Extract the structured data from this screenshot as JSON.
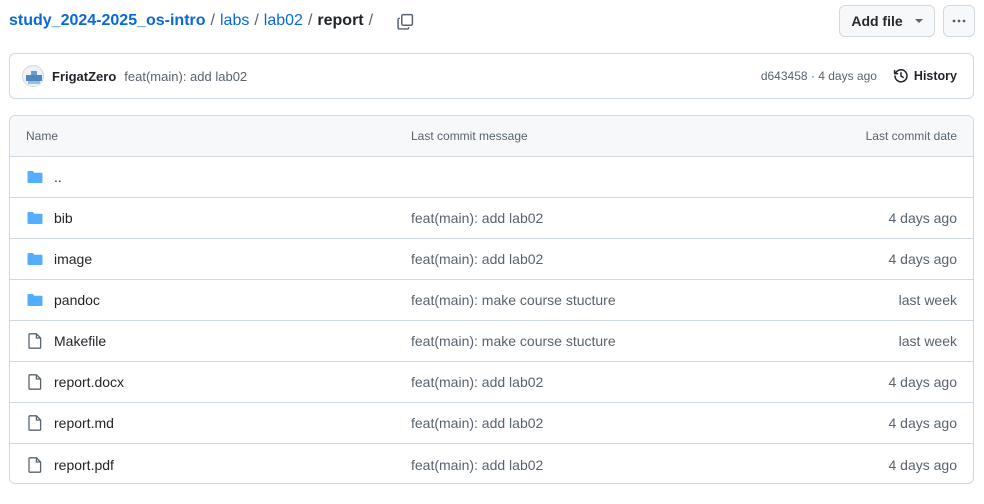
{
  "breadcrumb": {
    "repo": "study_2024-2025_os-intro",
    "parts": [
      "labs",
      "lab02"
    ],
    "current": "report",
    "separator": "/"
  },
  "actions": {
    "add_file_label": "Add file",
    "more_icon": "kebab-horizontal-icon",
    "copy_icon": "copy-icon"
  },
  "latest_commit": {
    "author": "FrigatZero",
    "message": "feat(main): add lab02",
    "meta": "d643458 · 4 days ago",
    "history_label": "History"
  },
  "table": {
    "headers": {
      "name": "Name",
      "message": "Last commit message",
      "date": "Last commit date"
    },
    "parent": "..",
    "rows": [
      {
        "type": "dir",
        "name": "bib",
        "message": "feat(main): add lab02",
        "date": "4 days ago"
      },
      {
        "type": "dir",
        "name": "image",
        "message": "feat(main): add lab02",
        "date": "4 days ago"
      },
      {
        "type": "dir",
        "name": "pandoc",
        "message": "feat(main): make course stucture",
        "date": "last week"
      },
      {
        "type": "file",
        "name": "Makefile",
        "message": "feat(main): make course stucture",
        "date": "last week"
      },
      {
        "type": "file",
        "name": "report.docx",
        "message": "feat(main): add lab02",
        "date": "4 days ago"
      },
      {
        "type": "file",
        "name": "report.md",
        "message": "feat(main): add lab02",
        "date": "4 days ago"
      },
      {
        "type": "file",
        "name": "report.pdf",
        "message": "feat(main): add lab02",
        "date": "4 days ago"
      }
    ]
  },
  "colors": {
    "link": "#0969da",
    "folder": "#54aeff",
    "muted": "#59636e",
    "border": "#d1d9e0"
  }
}
